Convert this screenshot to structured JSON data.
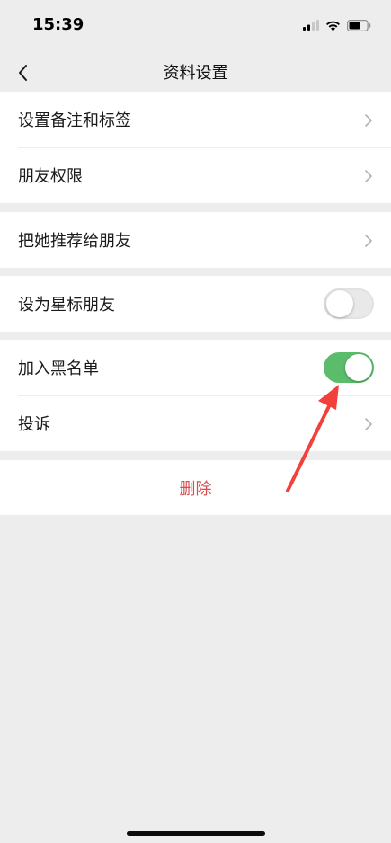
{
  "status_bar": {
    "time": "15:39"
  },
  "nav": {
    "title": "资料设置"
  },
  "rows": {
    "remark_tags": "设置备注和标签",
    "friend_permissions": "朋友权限",
    "recommend": "把她推荐给朋友",
    "star_friend": "设为星标朋友",
    "blacklist": "加入黑名单",
    "report": "投诉"
  },
  "toggles": {
    "star_friend_on": false,
    "blacklist_on": true
  },
  "delete": {
    "label": "删除"
  },
  "colors": {
    "background": "#ededed",
    "toggle_on": "#5bbd6b",
    "delete_text": "#d94c4c",
    "annotation_arrow": "#f2413a"
  },
  "icons": [
    "back-chevron-icon",
    "chevron-right-icon",
    "signal-icon",
    "wifi-icon",
    "battery-icon"
  ]
}
